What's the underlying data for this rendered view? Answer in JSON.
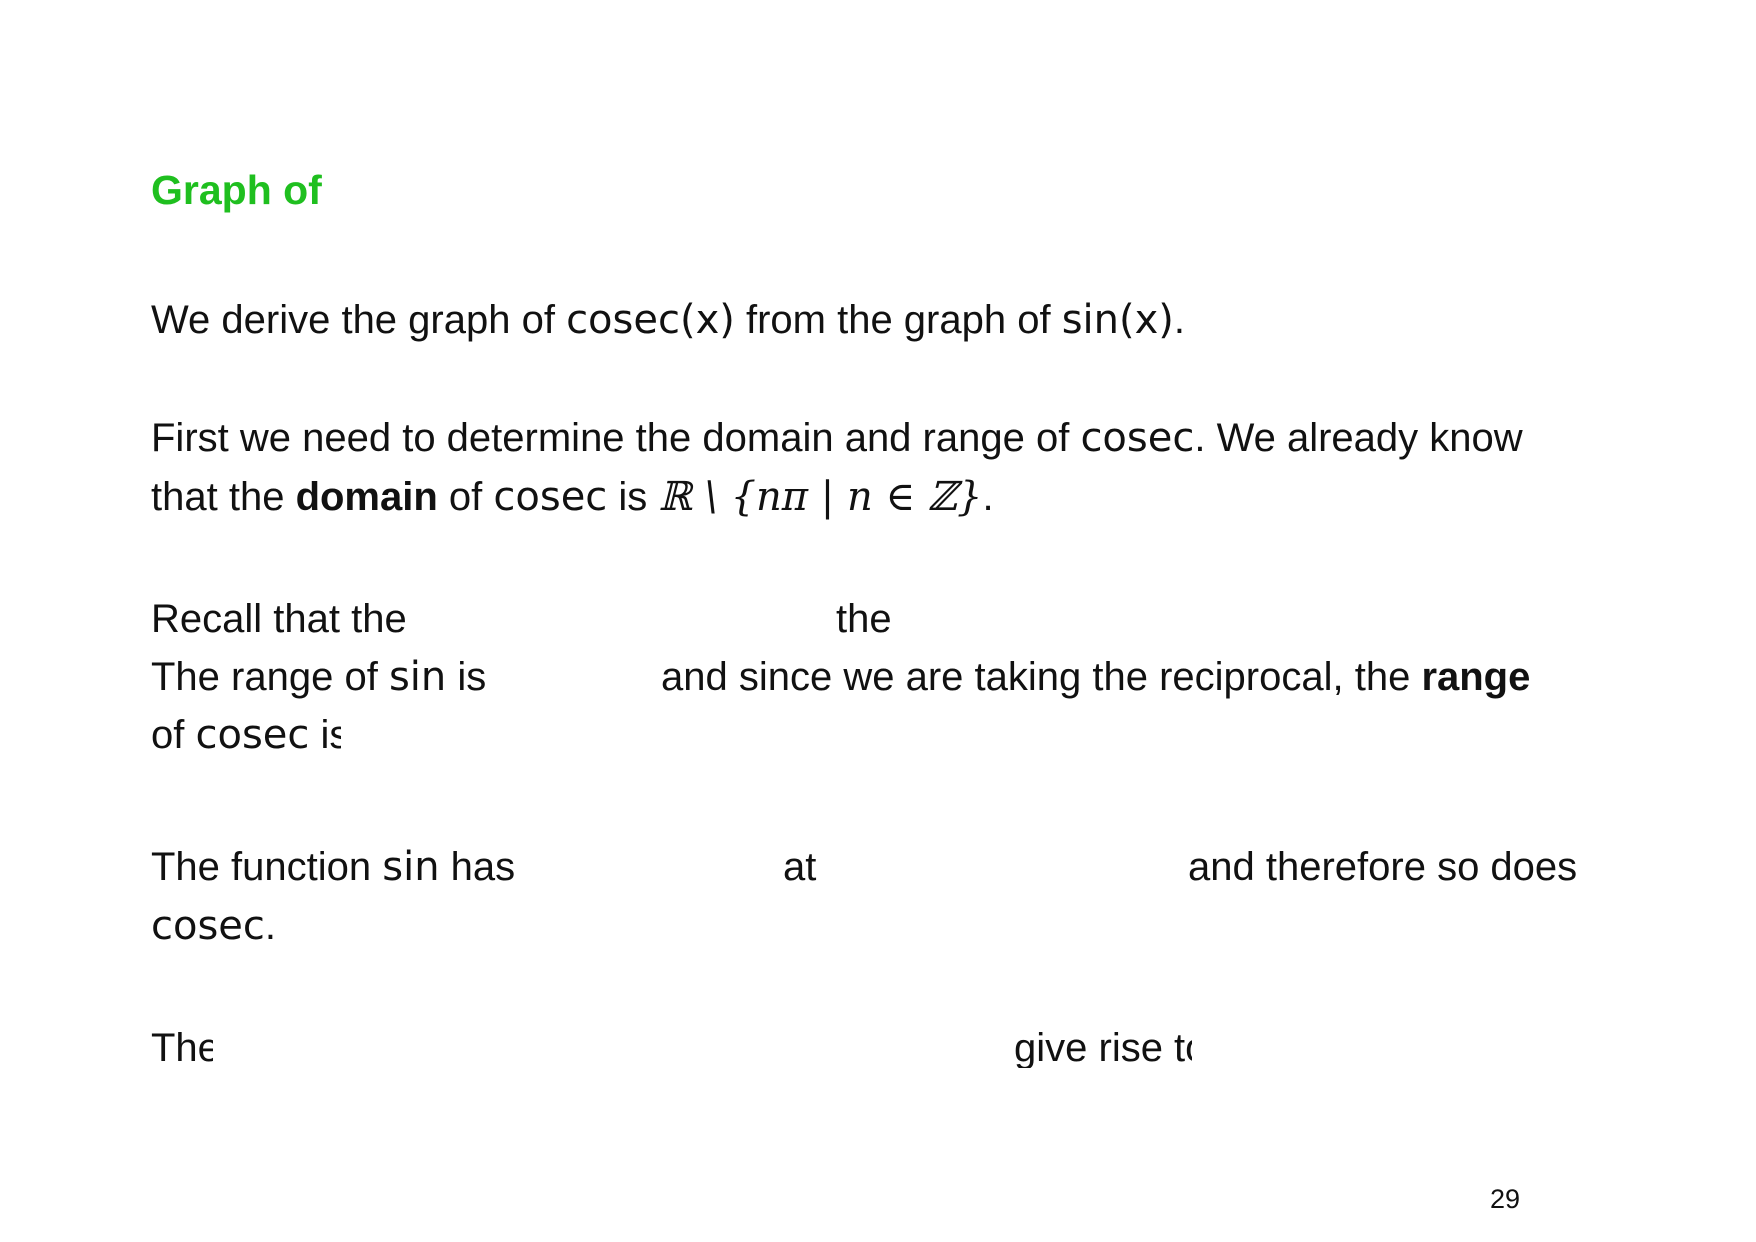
{
  "slide": {
    "title": "Graph of",
    "page_number": "29"
  },
  "para1": {
    "line1": {
      "t1": "We derive the graph of ",
      "m1": "cosec(x)",
      "t2": " from the graph of ",
      "m2": "sin(x)",
      "t3": "."
    }
  },
  "para2": {
    "line1": {
      "t1": "First we need to determine the domain and range of ",
      "m1": "cosec",
      "t2": ". We already know"
    },
    "line2": {
      "t1": "that the ",
      "b1": "domain",
      "t2": " of ",
      "m1": "cosec",
      "t3": " is ",
      "m2": "ℝ \\ {nπ | n ∈ ℤ}",
      "t4": "."
    }
  },
  "para3": {
    "line1": {
      "t1": "Recall that the",
      "t2": "the"
    },
    "line2": {
      "t1": "The range of ",
      "m1": "sin",
      "t2": " is",
      "t3": "and since we are taking the reciprocal, the ",
      "b1": "range"
    },
    "line3": {
      "t1": "of ",
      "m1": "cosec",
      "t2": " is"
    }
  },
  "para4": {
    "line1": {
      "t1": "The function ",
      "m1": "sin",
      "t2": " has",
      "t3": "at",
      "t4": "and therefore so does"
    },
    "line2": {
      "m1": "cosec",
      "t1": "."
    }
  },
  "para5": {
    "line1": {
      "t1": "The",
      "t2": "give rise to"
    }
  }
}
